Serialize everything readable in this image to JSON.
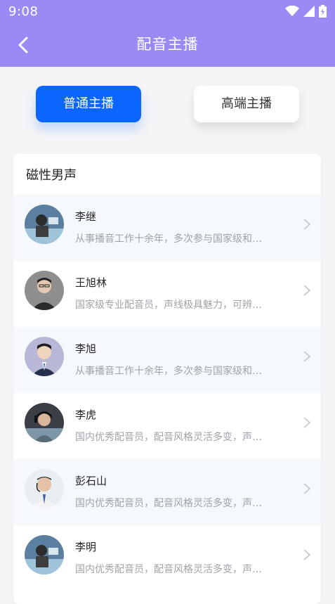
{
  "status": {
    "time": "9:08"
  },
  "nav": {
    "title": "配音主播"
  },
  "tabs": [
    {
      "label": "普通主播",
      "active": true
    },
    {
      "label": "高端主播",
      "active": false
    }
  ],
  "section": {
    "title": "磁性男声",
    "items": [
      {
        "name": "李继",
        "desc": "从事播音工作十余年，多次参与国家级和…"
      },
      {
        "name": "王旭林",
        "desc": "国家级专业配音员，声线极具魅力，可辨…"
      },
      {
        "name": "李旭",
        "desc": "从事播音工作十余年，多次参与国家级和…"
      },
      {
        "name": "李虎",
        "desc": "国内优秀配音员，配音风格灵活多变，声…"
      },
      {
        "name": "彭石山",
        "desc": "国内优秀配音员，配音风格灵活多变，声…"
      },
      {
        "name": "李明",
        "desc": "国内优秀配音员，配音风格灵活多变，声…"
      }
    ]
  },
  "colors": {
    "header": "#9a8af5",
    "tab_active": "#0a66ff",
    "row_alt": "#f5f8fd",
    "desc_text": "#a0a3aa"
  },
  "icons": [
    "wifi-icon",
    "signal-icon",
    "battery-icon",
    "back-arrow-icon",
    "chevron-right-icon"
  ]
}
